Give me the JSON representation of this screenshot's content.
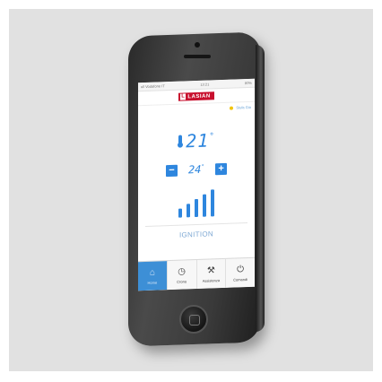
{
  "status_bar": {
    "carrier": "ull Vodafone IT",
    "time": "13:21",
    "battery": "80%"
  },
  "brand": {
    "name": "LASIAN",
    "mark": "L"
  },
  "device": {
    "name": "Stufa Gio",
    "icon": "sun-icon"
  },
  "ambient_temperature": {
    "value": "21",
    "unit": "°",
    "icon": "thermometer-icon"
  },
  "setpoint": {
    "value": "24",
    "unit": "°",
    "minus_label": "−",
    "plus_label": "+"
  },
  "power_level": {
    "level": 5,
    "max": 5
  },
  "status": {
    "text": "IGNITION"
  },
  "tabs": [
    {
      "label": "Home",
      "icon": "home-icon",
      "active": true
    },
    {
      "label": "Crono",
      "icon": "clock-icon",
      "active": false
    },
    {
      "label": "Assistenza",
      "icon": "wrench-icon",
      "active": false
    },
    {
      "label": "Comandi",
      "icon": "power-icon",
      "active": false
    }
  ],
  "colors": {
    "accent": "#2e86de",
    "brand": "#c8102e",
    "tab_active": "#3d8fd6"
  }
}
